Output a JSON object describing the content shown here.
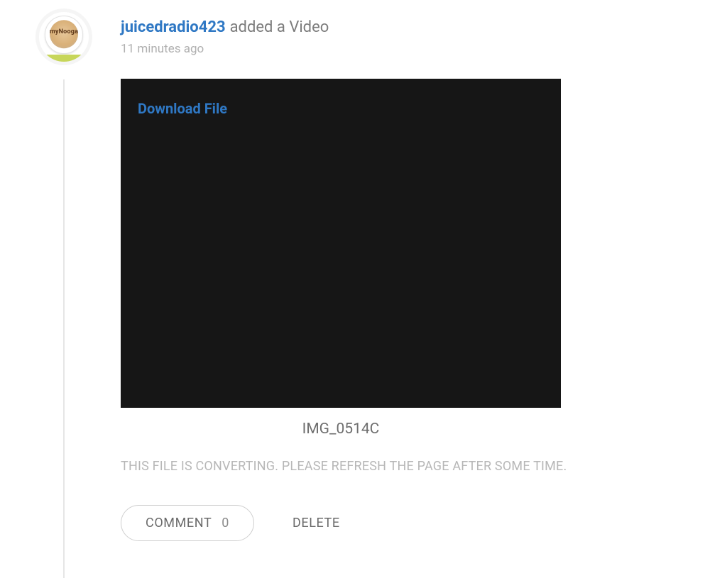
{
  "post": {
    "avatar_label": "myNooga",
    "username": "juicedradio423",
    "action_text": "added a Video",
    "timestamp": "11 minutes ago"
  },
  "video": {
    "download_link_text": "Download File",
    "filename": "IMG_0514C",
    "converting_message": "THIS FILE IS CONVERTING. PLEASE REFRESH THE PAGE AFTER SOME TIME."
  },
  "actions": {
    "comment_label": "COMMENT",
    "comment_count": "0",
    "delete_label": "DELETE"
  }
}
